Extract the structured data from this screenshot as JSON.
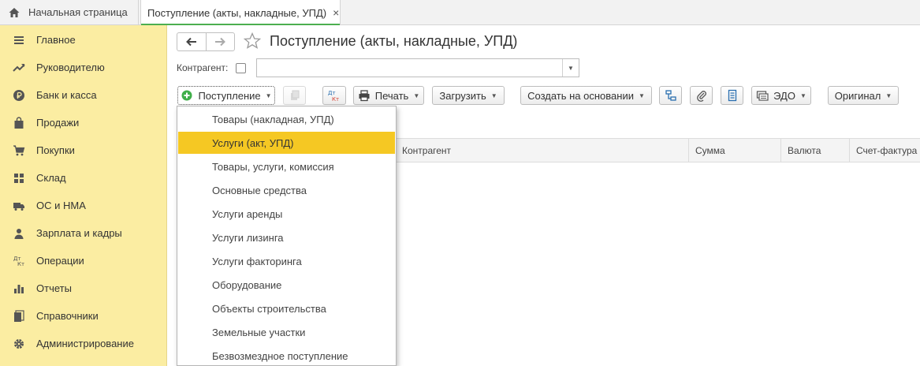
{
  "tabs": {
    "home_label": "Начальная страница",
    "active_label": "Поступление (акты, накладные, УПД)",
    "close_glyph": "×"
  },
  "sidebar": {
    "items": [
      {
        "label": "Главное",
        "icon": "menu-lines-icon"
      },
      {
        "label": "Руководителю",
        "icon": "trend-icon"
      },
      {
        "label": "Банк и касса",
        "icon": "ruble-icon"
      },
      {
        "label": "Продажи",
        "icon": "bag-icon"
      },
      {
        "label": "Покупки",
        "icon": "cart-icon"
      },
      {
        "label": "Склад",
        "icon": "warehouse-icon"
      },
      {
        "label": "ОС и НМА",
        "icon": "truck-icon"
      },
      {
        "label": "Зарплата и кадры",
        "icon": "person-icon"
      },
      {
        "label": "Операции",
        "icon": "dt-kt-icon"
      },
      {
        "label": "Отчеты",
        "icon": "bar-chart-icon"
      },
      {
        "label": "Справочники",
        "icon": "books-icon"
      },
      {
        "label": "Администрирование",
        "icon": "gear-icon"
      }
    ]
  },
  "header": {
    "title": "Поступление (акты, накладные, УПД)",
    "back_glyph": "🡐",
    "forward_glyph": "🡒",
    "star_glyph": "☆"
  },
  "filter": {
    "label": "Контрагент:",
    "value": "",
    "dropdown_glyph": "▼"
  },
  "toolbar": {
    "receipt_label": "Поступление",
    "dtkt_top": "Дт",
    "dtkt_bottom": "Кт",
    "print_label": "Печать",
    "load_label": "Загрузить",
    "create_based_label": "Создать на основании",
    "edo_label": "ЭДО",
    "original_label": "Оригинал",
    "caret_glyph": "▼"
  },
  "grid": {
    "columns": [
      "Контрагент",
      "Сумма",
      "Валюта",
      "Счет-фактура"
    ]
  },
  "menu": {
    "selected_index": 1,
    "items": [
      "Товары (накладная, УПД)",
      "Услуги (акт, УПД)",
      "Товары, услуги, комиссия",
      "Основные средства",
      "Услуги аренды",
      "Услуги лизинга",
      "Услуги факторинга",
      "Оборудование",
      "Объекты строительства",
      "Земельные участки",
      "Безвозмездное поступление"
    ]
  },
  "colors": {
    "sidebar_bg": "#fbeda2",
    "menu_highlight": "#f5c823",
    "tab_underline": "#4caf50",
    "add_icon": "#3fae49"
  }
}
